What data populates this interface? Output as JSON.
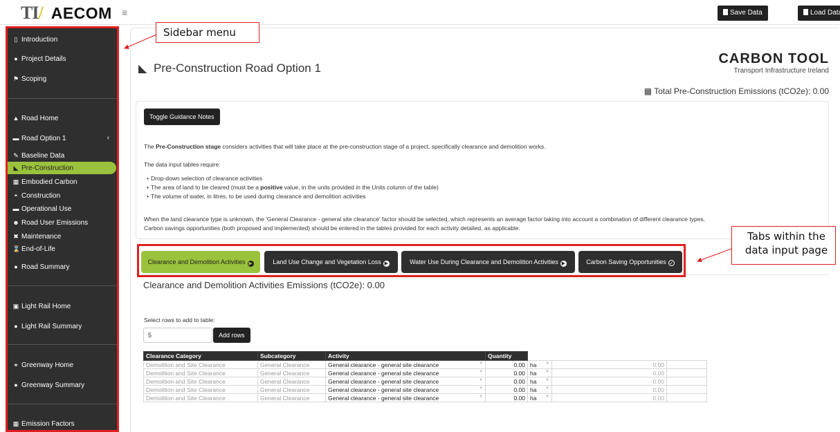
{
  "topbar": {
    "logo_tii": "TII",
    "logo_aecom": "AECOM",
    "menu_icon": "hamburger-icon",
    "save_label": "Save Data",
    "load_label": "Load Data"
  },
  "sidebar": {
    "items": [
      {
        "label": "Introduction",
        "icon": "bridge-icon"
      },
      {
        "label": "Project Details",
        "icon": "info-circle-icon"
      },
      {
        "label": "Scoping",
        "icon": "flag-icon"
      },
      {
        "label": "Road Home",
        "icon": "road-icon"
      },
      {
        "label": "Road Option 1",
        "icon": "car-icon"
      },
      {
        "label": "Baseline Data",
        "icon": "pencil-icon"
      },
      {
        "label": "Pre-Construction",
        "icon": "excavator-icon"
      },
      {
        "label": "Embodied Carbon",
        "icon": "calculator-icon"
      },
      {
        "label": "Construction",
        "icon": "hardhat-icon"
      },
      {
        "label": "Operational Use",
        "icon": "car-icon"
      },
      {
        "label": "Road User Emissions",
        "icon": "users-icon"
      },
      {
        "label": "Maintenance",
        "icon": "tools-icon"
      },
      {
        "label": "End-of-Life",
        "icon": "hourglass-icon"
      },
      {
        "label": "Road Summary",
        "icon": "info-circle-icon"
      },
      {
        "label": "Light Rail Home",
        "icon": "train-icon"
      },
      {
        "label": "Light Rail Summary",
        "icon": "info-circle-icon"
      },
      {
        "label": "Greenway Home",
        "icon": "bicycle-icon"
      },
      {
        "label": "Greenway Summary",
        "icon": "info-circle-icon"
      },
      {
        "label": "Emission Factors",
        "icon": "calculator-icon"
      }
    ],
    "collapse_chevron": "‹"
  },
  "annotations": {
    "sidebar_callout": "Sidebar menu",
    "tabs_callout_line1": "Tabs within the",
    "tabs_callout_line2": "data input page"
  },
  "main": {
    "page_title": "Pre-Construction Road Option 1",
    "brand_name": "CARBON TOOL",
    "brand_sub": "Transport Infrastructure Ireland",
    "total_emissions": "Total Pre-Construction Emissions (tCO2e): 0.00"
  },
  "guidance": {
    "toggle_label": "Toggle Guidance Notes",
    "p1_pre": "The ",
    "p1_bold": "Pre-Construction stage",
    "p1_post": " considers activities that will take place at the pre-construction stage of a project, specifically clearance and demolition works.",
    "p2": "The data input tables require:",
    "bullet1": "Drop-down selection of clearance activities",
    "bullet2_pre": "The area of land to be cleared (must be a ",
    "bullet2_bold": "positive",
    "bullet2_post": " value, in the units provided in the Units column of the table)",
    "bullet3": "The volume of water, in litres, to be used during clearance and demolition activities",
    "p3": "When the land clearance type is unknown, the 'General Clearance - general site clearance' factor should be selected, which represents an average factor taking into account a combination of different clearance types.",
    "p4": "Carbon savings opportunities (both proposed and implemented) should be entered in the tables provided for each activity detailed, as applicable."
  },
  "tabs": [
    {
      "label": "Clearance and Demolition Activities",
      "active": true
    },
    {
      "label": "Land Use Change and Vegetation Loss",
      "active": false
    },
    {
      "label": "Water Use During Clearance and Demolition Activities",
      "active": false
    },
    {
      "label": "Carbon Saving Opportunities",
      "active": false
    }
  ],
  "section": {
    "title": "Clearance and Demolition Activities Emissions (tCO2e): 0.00",
    "rows_label": "Select rows to add to table:",
    "rows_value": "5",
    "add_rows_label": "Add rows"
  },
  "table": {
    "headers": [
      "Clearance Category",
      "Subcategory",
      "Activity",
      "Quantity"
    ],
    "rows": [
      [
        "Demolition and Site Clearance",
        "General Clearance",
        "General clearance - general site clearance",
        "0.00",
        "ha",
        "0.00"
      ],
      [
        "Demolition and Site Clearance",
        "General Clearance",
        "General clearance - general site clearance",
        "0.00",
        "ha",
        "0.00"
      ],
      [
        "Demolition and Site Clearance",
        "General Clearance",
        "General clearance - general site clearance",
        "0.00",
        "ha",
        "0.00"
      ],
      [
        "Demolition and Site Clearance",
        "General Clearance",
        "General clearance - general site clearance",
        "0.00",
        "ha",
        "0.00"
      ],
      [
        "Demolition and Site Clearance",
        "General Clearance",
        "General clearance - general site clearance",
        "0.00",
        "ha",
        "0.00"
      ]
    ]
  },
  "colors": {
    "accent_green": "#9bc23c",
    "dark": "#2f2f2f",
    "annotation_red": "#e02020"
  }
}
